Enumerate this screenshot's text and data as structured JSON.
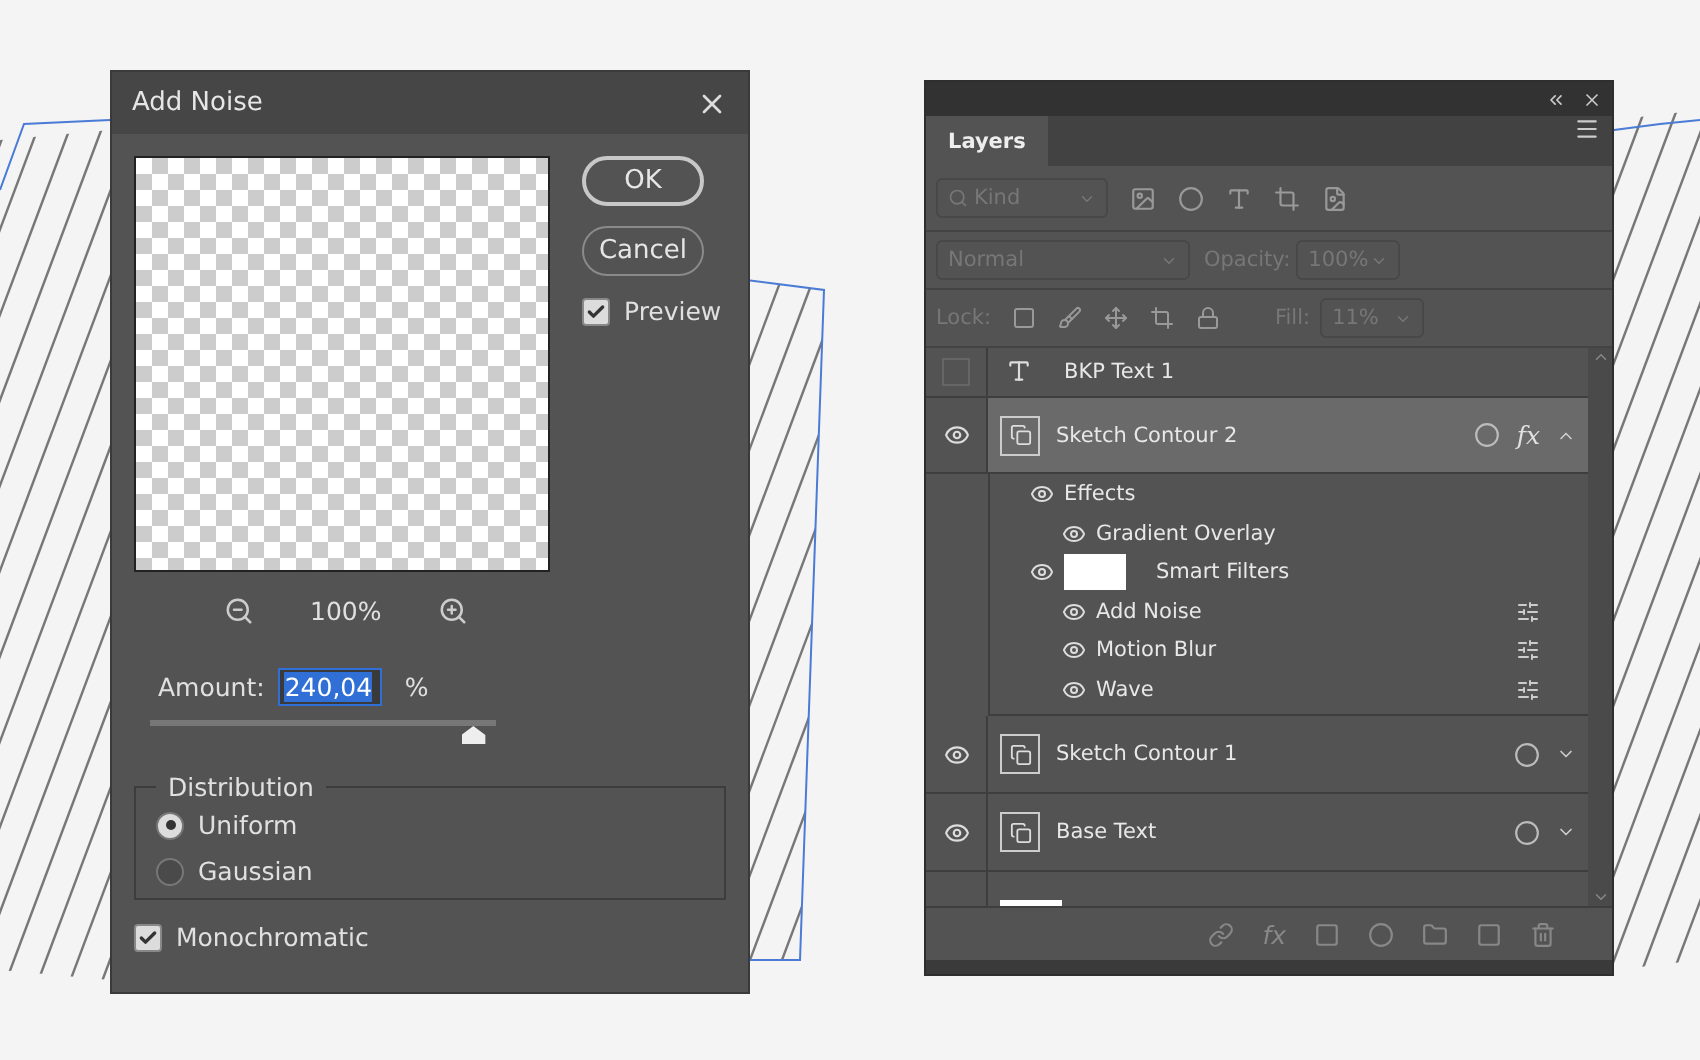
{
  "add_noise": {
    "title": "Add Noise",
    "buttons": [
      "OK",
      "Cancel"
    ],
    "preview": {
      "label": "Preview",
      "checked": true
    },
    "zoom": "100%",
    "amount": {
      "label": "Amount:",
      "value": "240,04",
      "unit": "%",
      "level": 0.92
    },
    "distribution": {
      "title": "Distribution",
      "options": [
        {
          "label": "Uniform",
          "selected": true
        },
        {
          "label": "Gaussian",
          "selected": false
        }
      ]
    },
    "monochromatic": {
      "label": "Monochromatic",
      "checked": true
    }
  },
  "layers_panel": {
    "tab": "Layers",
    "filter": {
      "placeholder": "Kind"
    },
    "blend_mode": "Normal",
    "opacity": {
      "label": "Opacity:",
      "value": "100%"
    },
    "lock_label": "Lock:",
    "footer_fx": "fx",
    "fill": {
      "label": "Fill:",
      "value": "11%"
    },
    "layers": [
      {
        "kind": "text",
        "name": "BKP Text 1",
        "visible": false,
        "selected": false
      },
      {
        "kind": "smart",
        "name": "Sketch Contour 2",
        "visible": true,
        "selected": true,
        "fx": "fx",
        "expanded": true,
        "effects": {
          "label": "Effects",
          "items": [
            "Gradient Overlay"
          ]
        },
        "smart_filters": {
          "label": "Smart Filters",
          "items": [
            "Add Noise",
            "Motion Blur",
            "Wave"
          ]
        }
      },
      {
        "kind": "smart",
        "name": "Sketch Contour 1",
        "visible": true,
        "selected": false,
        "expanded": false
      },
      {
        "kind": "smart",
        "name": "Base Text",
        "visible": true,
        "selected": false,
        "expanded": false
      },
      {
        "kind": "cut"
      }
    ]
  }
}
